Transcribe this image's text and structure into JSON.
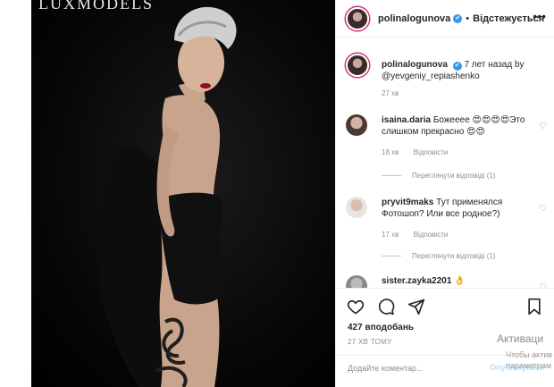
{
  "photo": {
    "watermark": "LUXMODELS"
  },
  "header": {
    "username": "polinalogunova",
    "verified": "✔",
    "dot": "•",
    "follow_label": "Відстежується",
    "more": "•••"
  },
  "caption": {
    "username": "polinalogunova",
    "text": "7 лет назад by @yevgeniy_repiashenko",
    "time": "27 хв"
  },
  "comments": [
    {
      "username": "isaina.daria",
      "text": "Божееее 😍😍😍😍Это слишком прекрасно 😍😍",
      "time": "18 хв",
      "reply_label": "Відповісти",
      "view_replies": "Переглянути відповіді (1)"
    },
    {
      "username": "pryvit9maks",
      "text": "Тут применялся Фотошоп? Или все родное?)",
      "time": "17 хв",
      "reply_label": "Відповісти",
      "view_replies": "Переглянути відповіді (1)"
    },
    {
      "username": "sister.zayka2201",
      "text": "👌"
    }
  ],
  "actions": {
    "likes": "427 вподобань",
    "timestamp": "27 ХВ ТОМУ",
    "add_comment_placeholder": "Додайте коментар...",
    "publish_label": "Опублікувати"
  },
  "os_overlay": {
    "line1": "Активаци",
    "line2": "Чтобы актив",
    "line3": "параметрам"
  },
  "colors": {
    "verified": "#3897f0",
    "story_ring": "#d62976",
    "publish": "#b2dffc"
  }
}
